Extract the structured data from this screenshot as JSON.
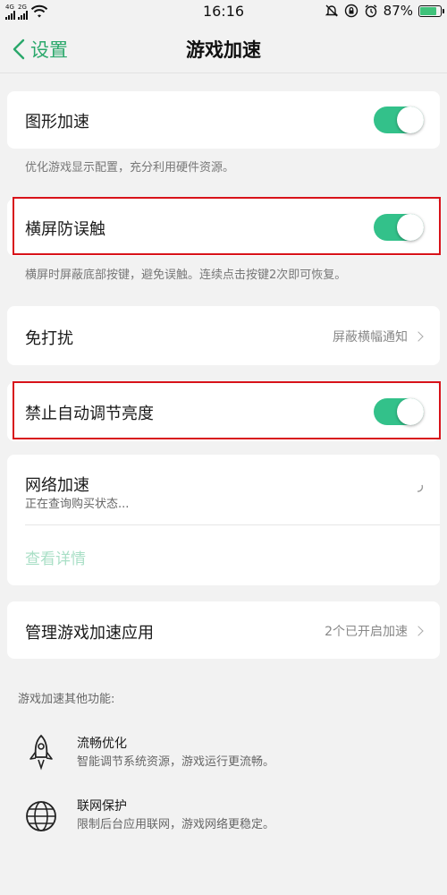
{
  "status_bar": {
    "network": "4G",
    "network2": "2G",
    "time": "16:16",
    "battery": "87%",
    "battery_level": 0.87
  },
  "nav": {
    "back_label": "设置",
    "title": "游戏加速"
  },
  "settings": {
    "graphics": {
      "label": "图形加速",
      "enabled": true,
      "description": "优化游戏显示配置，充分利用硬件资源。"
    },
    "landscape": {
      "label": "横屏防误触",
      "enabled": true,
      "description": "横屏时屏蔽底部按键，避免误触。连续点击按键2次即可恢复。"
    },
    "dnd": {
      "label": "免打扰",
      "value": "屏蔽横幅通知"
    },
    "brightness": {
      "label": "禁止自动调节亮度",
      "enabled": true
    },
    "network": {
      "label": "网络加速",
      "status": "正在查询购买状态...",
      "details": "查看详情"
    },
    "manage": {
      "label": "管理游戏加速应用",
      "value": "2个已开启加速"
    }
  },
  "other": {
    "section_title": "游戏加速其他功能:",
    "features": [
      {
        "icon": "rocket-icon",
        "title": "流畅优化",
        "desc": "智能调节系统资源，游戏运行更流畅。"
      },
      {
        "icon": "globe-icon",
        "title": "联网保护",
        "desc": "限制后台应用联网，游戏网络更稳定。"
      }
    ]
  },
  "colors": {
    "accent": "#33c18a",
    "back_text": "#2aa86b",
    "highlight": "#d8131a"
  }
}
